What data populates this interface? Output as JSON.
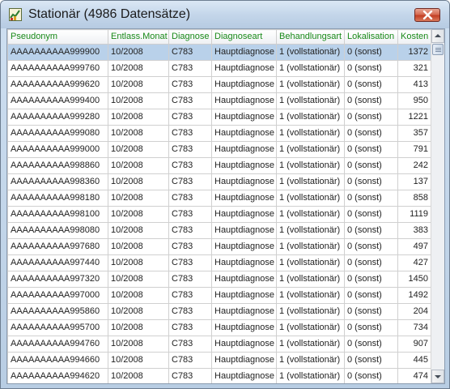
{
  "window": {
    "title": "Stationär (4986 Datensätze)",
    "close_icon": "close-icon",
    "app_icon": "chart-app-icon"
  },
  "table": {
    "columns": [
      "Pseudonym",
      "Entlass.Monat",
      "Diagnose",
      "Diagnoseart",
      "Behandlungsart",
      "Lokalisation",
      "Kosten"
    ],
    "rows": [
      [
        "AAAAAAAAAA999900",
        "10/2008",
        "C783",
        "Hauptdiagnose",
        "1 (vollstationär)",
        "0 (sonst)",
        "1372"
      ],
      [
        "AAAAAAAAAA999760",
        "10/2008",
        "C783",
        "Hauptdiagnose",
        "1 (vollstationär)",
        "0 (sonst)",
        "321"
      ],
      [
        "AAAAAAAAAA999620",
        "10/2008",
        "C783",
        "Hauptdiagnose",
        "1 (vollstationär)",
        "0 (sonst)",
        "413"
      ],
      [
        "AAAAAAAAAA999400",
        "10/2008",
        "C783",
        "Hauptdiagnose",
        "1 (vollstationär)",
        "0 (sonst)",
        "950"
      ],
      [
        "AAAAAAAAAA999280",
        "10/2008",
        "C783",
        "Hauptdiagnose",
        "1 (vollstationär)",
        "0 (sonst)",
        "1221"
      ],
      [
        "AAAAAAAAAA999080",
        "10/2008",
        "C783",
        "Hauptdiagnose",
        "1 (vollstationär)",
        "0 (sonst)",
        "357"
      ],
      [
        "AAAAAAAAAA999000",
        "10/2008",
        "C783",
        "Hauptdiagnose",
        "1 (vollstationär)",
        "0 (sonst)",
        "791"
      ],
      [
        "AAAAAAAAAA998860",
        "10/2008",
        "C783",
        "Hauptdiagnose",
        "1 (vollstationär)",
        "0 (sonst)",
        "242"
      ],
      [
        "AAAAAAAAAA998360",
        "10/2008",
        "C783",
        "Hauptdiagnose",
        "1 (vollstationär)",
        "0 (sonst)",
        "137"
      ],
      [
        "AAAAAAAAAA998180",
        "10/2008",
        "C783",
        "Hauptdiagnose",
        "1 (vollstationär)",
        "0 (sonst)",
        "858"
      ],
      [
        "AAAAAAAAAA998100",
        "10/2008",
        "C783",
        "Hauptdiagnose",
        "1 (vollstationär)",
        "0 (sonst)",
        "1119"
      ],
      [
        "AAAAAAAAAA998080",
        "10/2008",
        "C783",
        "Hauptdiagnose",
        "1 (vollstationär)",
        "0 (sonst)",
        "383"
      ],
      [
        "AAAAAAAAAA997680",
        "10/2008",
        "C783",
        "Hauptdiagnose",
        "1 (vollstationär)",
        "0 (sonst)",
        "497"
      ],
      [
        "AAAAAAAAAA997440",
        "10/2008",
        "C783",
        "Hauptdiagnose",
        "1 (vollstationär)",
        "0 (sonst)",
        "427"
      ],
      [
        "AAAAAAAAAA997320",
        "10/2008",
        "C783",
        "Hauptdiagnose",
        "1 (vollstationär)",
        "0 (sonst)",
        "1450"
      ],
      [
        "AAAAAAAAAA997000",
        "10/2008",
        "C783",
        "Hauptdiagnose",
        "1 (vollstationär)",
        "0 (sonst)",
        "1492"
      ],
      [
        "AAAAAAAAAA995860",
        "10/2008",
        "C783",
        "Hauptdiagnose",
        "1 (vollstationär)",
        "0 (sonst)",
        "204"
      ],
      [
        "AAAAAAAAAA995700",
        "10/2008",
        "C783",
        "Hauptdiagnose",
        "1 (vollstationär)",
        "0 (sonst)",
        "734"
      ],
      [
        "AAAAAAAAAA994760",
        "10/2008",
        "C783",
        "Hauptdiagnose",
        "1 (vollstationär)",
        "0 (sonst)",
        "907"
      ],
      [
        "AAAAAAAAAA994660",
        "10/2008",
        "C783",
        "Hauptdiagnose",
        "1 (vollstationär)",
        "0 (sonst)",
        "445"
      ],
      [
        "AAAAAAAAAA994620",
        "10/2008",
        "C783",
        "Hauptdiagnose",
        "1 (vollstationär)",
        "0 (sonst)",
        "474"
      ]
    ],
    "selected_row": 0
  },
  "scrollbar": {
    "up_icon": "scroll-up-arrow-icon",
    "down_icon": "scroll-down-arrow-icon"
  },
  "colors": {
    "header_text": "#1a8a1a",
    "selected_row_bg": "#b9d1ea",
    "close_button": "#c33f25"
  }
}
